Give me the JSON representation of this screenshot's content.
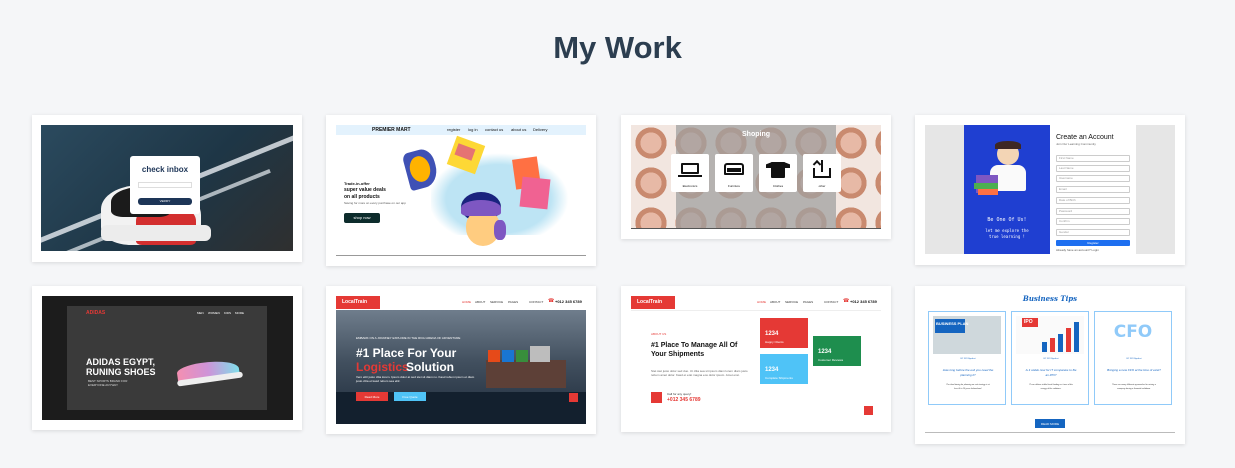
{
  "title": "My Work",
  "colors": {
    "accent_red": "#e53935",
    "blue": "#1565c0",
    "green": "#1e8e4e",
    "cyan": "#4fc3f7"
  },
  "projects": [
    {
      "inbox_heading": "check inbox",
      "button_label": "VERIFY"
    },
    {
      "brand": "PREMIER MART",
      "nav": [
        "register",
        "log in",
        "contact us",
        "about us",
        "Delivery"
      ],
      "tagline": "Trade-in-offer",
      "headline_1": "super value deals",
      "headline_2": "on all products",
      "sub": "Saving for more on every purchase on our app",
      "cta": "shop now"
    },
    {
      "heading": "Shoping",
      "categories": [
        "Electronics",
        "Furniture",
        "Clothes",
        "other"
      ]
    },
    {
      "heading": "Create an Account",
      "sub": "Join Our Learning Community",
      "fields": [
        "First Name",
        "Last Name",
        "Username",
        "Email",
        "Date of Birth",
        "Password",
        "Confirm",
        "Gender"
      ],
      "submit": "Register",
      "login_hint": "Already have an account? Login",
      "motto_1": "Be One Of Us!",
      "motto_2": "let me explore the",
      "motto_3": "true learning !"
    },
    {
      "brand": "ADIDAS",
      "nav": [
        "MEN",
        "WOMEN",
        "KIDS",
        "MORE"
      ],
      "headline_1": "ADIDAS EGYPT,",
      "headline_2": "RUNING SHOES",
      "sub_1": "BEST SPORTS BRAND FOR",
      "sub_2": "EVERYONE ANYWAY"
    },
    {
      "brand": "LocalTrain",
      "nav": [
        "HOME",
        "ABOUT",
        "SERVICE",
        "PAGES",
        "CONTACT"
      ],
      "phone": "+012 345 6789",
      "eyebrow": "EMBARK ON A JOURNEY EXPLORE IN THE RICH ARENA OF ADVENTURE",
      "headline_1": "#1 Place For Your",
      "headline_2a": "Logistics",
      "headline_2b": "Solution",
      "body": "Vero elitr justo clita lorem. Ipsum dolor at sed stet sit diam no. Kasd rebum ipsum et diam justo clita et kasd rebum sea elitr.",
      "btn_1": "Read More",
      "btn_2": "Free Quote"
    },
    {
      "brand": "LocalTrain",
      "nav": [
        "HOME",
        "ABOUT",
        "SERVICE",
        "PAGES",
        "CONTACT"
      ],
      "phone": "+012 345 6789",
      "eyebrow": "ABOUT US",
      "headline_1": "#1 Place To Manage All Of",
      "headline_2": "Your Shipments",
      "body": "Stet stet justo dolor sed duo. Ut clita sea sit ipsum diam lorem diam justo rebum amet dolor. Kasd et erat magna eos dolor ipsum. Amet erat.",
      "call_label": "Call for any query!",
      "call_phone": "+012 345 6789",
      "stats": [
        {
          "number": "1234",
          "label": "Happy Clients"
        },
        {
          "number": "1234",
          "label": "Complete Shipments"
        },
        {
          "number": "1234",
          "label": "Customer Reviews"
        }
      ]
    },
    {
      "heading": "Business Tips",
      "tips": [
        {
          "image_text": "BUSINESS PLAN",
          "author": "BY XXX Byrdicat",
          "title_1": "How long before the exit you need the",
          "title_2": "planning it?",
          "body_1": "The ideal timing for planning an exit strategy is at",
          "body_2": "least 5 to 10 years beforehand."
        },
        {
          "image_text": "IPO",
          "author": "BY XXX Byrdicat",
          "title_1": "Is it viable now for IT companies to file",
          "title_2": "an IPO?",
          "body_1": "IT can deliver stable fiscal funding as it one of the",
          "body_2": "energy of the solutions."
        },
        {
          "image_text": "CFO",
          "author": "BY XXX Byrdicat",
          "title_1": "Bringing a new CFO at the time of exist?",
          "title_2": "",
          "body_1": "There are many different approaches for raising a",
          "body_2": "company during a financial meltdown."
        }
      ],
      "cta": "READ MORE"
    }
  ]
}
